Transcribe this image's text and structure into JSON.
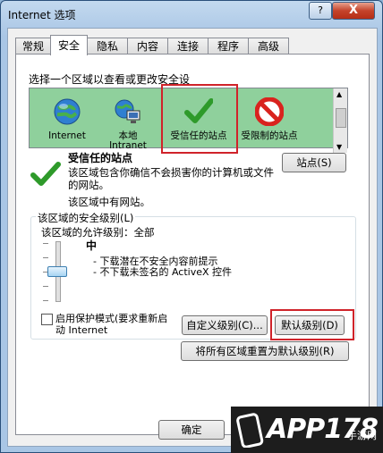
{
  "window": {
    "title": "Internet 选项",
    "help": "?",
    "close": "X"
  },
  "tabs": [
    {
      "label": "常规"
    },
    {
      "label": "安全"
    },
    {
      "label": "隐私"
    },
    {
      "label": "内容"
    },
    {
      "label": "连接"
    },
    {
      "label": "程序"
    },
    {
      "label": "高级"
    }
  ],
  "zones_heading": "选择一个区域以查看或更改安全设",
  "zones": [
    {
      "label": "Internet",
      "icon": "globe-icon"
    },
    {
      "label": "本地\nIntranet",
      "icon": "intranet-icon"
    },
    {
      "label": "受信任的站点",
      "icon": "checkmark-icon"
    },
    {
      "label": "受限制的站点",
      "icon": "no-entry-icon"
    }
  ],
  "zone_info": {
    "title": "受信任的站点",
    "desc": "该区域包含你确信不会损害你的计算机或文件的网站。",
    "status": "该区域中有网站。",
    "sites_button": "站点(S)"
  },
  "security_level": {
    "group_label": "该区域的安全级别(L)",
    "allowed": "该区域的允许级别：全部",
    "level": "中",
    "bullets": [
      "- 下载潜在不安全内容前提示",
      "- 不下载未签名的 ActiveX 控件"
    ],
    "slider_level": "中"
  },
  "protected_mode": {
    "label": "启用保护模式(要求重新启动 Internet",
    "checked": false
  },
  "buttons": {
    "custom": "自定义级别(C)...",
    "default": "默认级别(D)",
    "reset_all": "将所有区域重置为默认级别(R)",
    "ok": "确定"
  },
  "watermark": {
    "text": "APP178",
    "subtext": "手游网"
  },
  "colors": {
    "zone_bg": "#8fd09c",
    "highlight": "#d0232a",
    "accent": "#3a8d2e"
  }
}
